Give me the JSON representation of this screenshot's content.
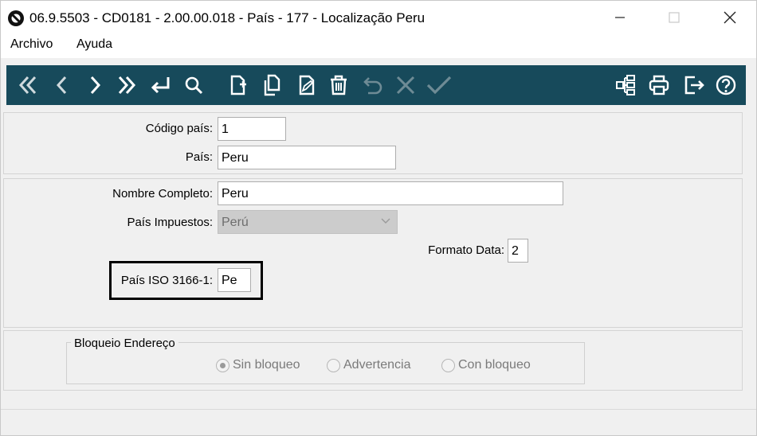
{
  "window": {
    "title": "06.9.5503 - CD0181 - 2.00.00.018 - País - 177 - Localização Peru",
    "controls": [
      "minimize",
      "maximize",
      "close"
    ]
  },
  "menu": {
    "items": [
      {
        "label": "Archivo"
      },
      {
        "label": "Ayuda"
      }
    ]
  },
  "toolbar": {
    "background": "#174a5b",
    "buttons": [
      {
        "icon": "first-record-icon"
      },
      {
        "icon": "previous-record-icon"
      },
      {
        "icon": "next-record-icon"
      },
      {
        "icon": "last-record-icon"
      },
      {
        "icon": "goto-enter-icon"
      },
      {
        "icon": "search-icon"
      },
      {
        "icon": "new-document-icon"
      },
      {
        "icon": "copy-document-icon"
      },
      {
        "icon": "edit-document-icon"
      },
      {
        "icon": "delete-trash-icon"
      },
      {
        "icon": "undo-icon"
      },
      {
        "icon": "cancel-x-icon"
      },
      {
        "icon": "confirm-check-icon"
      },
      {
        "icon": "tree-structure-icon"
      },
      {
        "icon": "print-icon"
      },
      {
        "icon": "exit-icon"
      },
      {
        "icon": "help-icon"
      }
    ]
  },
  "form": {
    "codigo_pais": {
      "label": "Código país:",
      "value": "1"
    },
    "pais": {
      "label": "País:",
      "value": "Peru"
    },
    "nombre_completo": {
      "label": "Nombre Completo:",
      "value": "Peru"
    },
    "pais_impuestos": {
      "label": "País Impuestos:",
      "value": "Perú"
    },
    "formato_data": {
      "label": "Formato Data:",
      "value": "2"
    },
    "pais_iso": {
      "label": "País ISO 3166-1:",
      "value": "Pe"
    }
  },
  "bloqueio": {
    "title": "Bloqueio Endereço",
    "options": [
      {
        "label": "Sin bloqueo",
        "selected": true
      },
      {
        "label": "Advertencia",
        "selected": false
      },
      {
        "label": "Con bloqueo",
        "selected": false
      }
    ]
  }
}
